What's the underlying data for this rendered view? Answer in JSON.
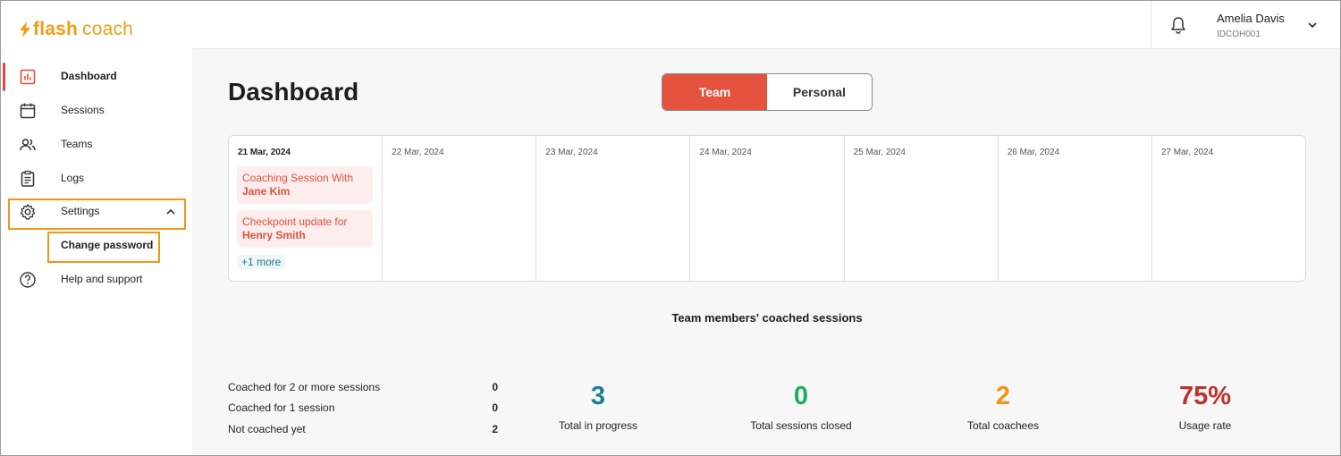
{
  "brand": {
    "name_bold": "flash",
    "name_light": "coach",
    "color": "#f39c12"
  },
  "sidebar": {
    "items": [
      {
        "label": "Dashboard",
        "icon": "bar-chart-icon",
        "active": true
      },
      {
        "label": "Sessions",
        "icon": "calendar-icon"
      },
      {
        "label": "Teams",
        "icon": "people-icon"
      },
      {
        "label": "Logs",
        "icon": "clipboard-icon"
      },
      {
        "label": "Settings",
        "icon": "gear-icon",
        "expanded": true
      },
      {
        "label": "Change password",
        "submenu": true
      },
      {
        "label": "Help and support",
        "icon": "help-circle-icon"
      }
    ]
  },
  "header": {
    "user_name": "Amelia Davis",
    "user_id": "IDCOH001"
  },
  "main": {
    "title": "Dashboard",
    "toggle": {
      "options": [
        "Team",
        "Personal"
      ],
      "selected": "Team"
    },
    "calendar": {
      "days": [
        {
          "date": "21 Mar, 2024",
          "events": [
            {
              "prefix": "Coaching Session With",
              "name": "Jane Kim"
            },
            {
              "prefix": "Checkpoint update for",
              "name": "Henry Smith"
            }
          ],
          "more": "+1 more"
        },
        {
          "date": "22 Mar, 2024"
        },
        {
          "date": "23 Mar, 2024"
        },
        {
          "date": "24 Mar, 2024"
        },
        {
          "date": "25 Mar, 2024"
        },
        {
          "date": "26 Mar, 2024"
        },
        {
          "date": "27 Mar, 2024"
        }
      ]
    },
    "coached": {
      "title": "Team members' coached sessions",
      "rows": [
        {
          "label": "Coached for 2 or more sessions",
          "value": "0"
        },
        {
          "label": "Coached for 1 session",
          "value": "0"
        },
        {
          "label": "Not coached yet",
          "value": "2"
        }
      ]
    },
    "kpis": [
      {
        "value": "3",
        "label": "Total in progress",
        "color": "#1a7f8f"
      },
      {
        "value": "0",
        "label": "Total sessions closed",
        "color": "#1fae5e"
      },
      {
        "value": "2",
        "label": "Total coachees",
        "color": "#f39617"
      },
      {
        "value": "75%",
        "label": "Usage rate",
        "color": "#c0302a"
      }
    ]
  },
  "colors": {
    "accent": "#e5533f",
    "highlight": "#f39617"
  }
}
